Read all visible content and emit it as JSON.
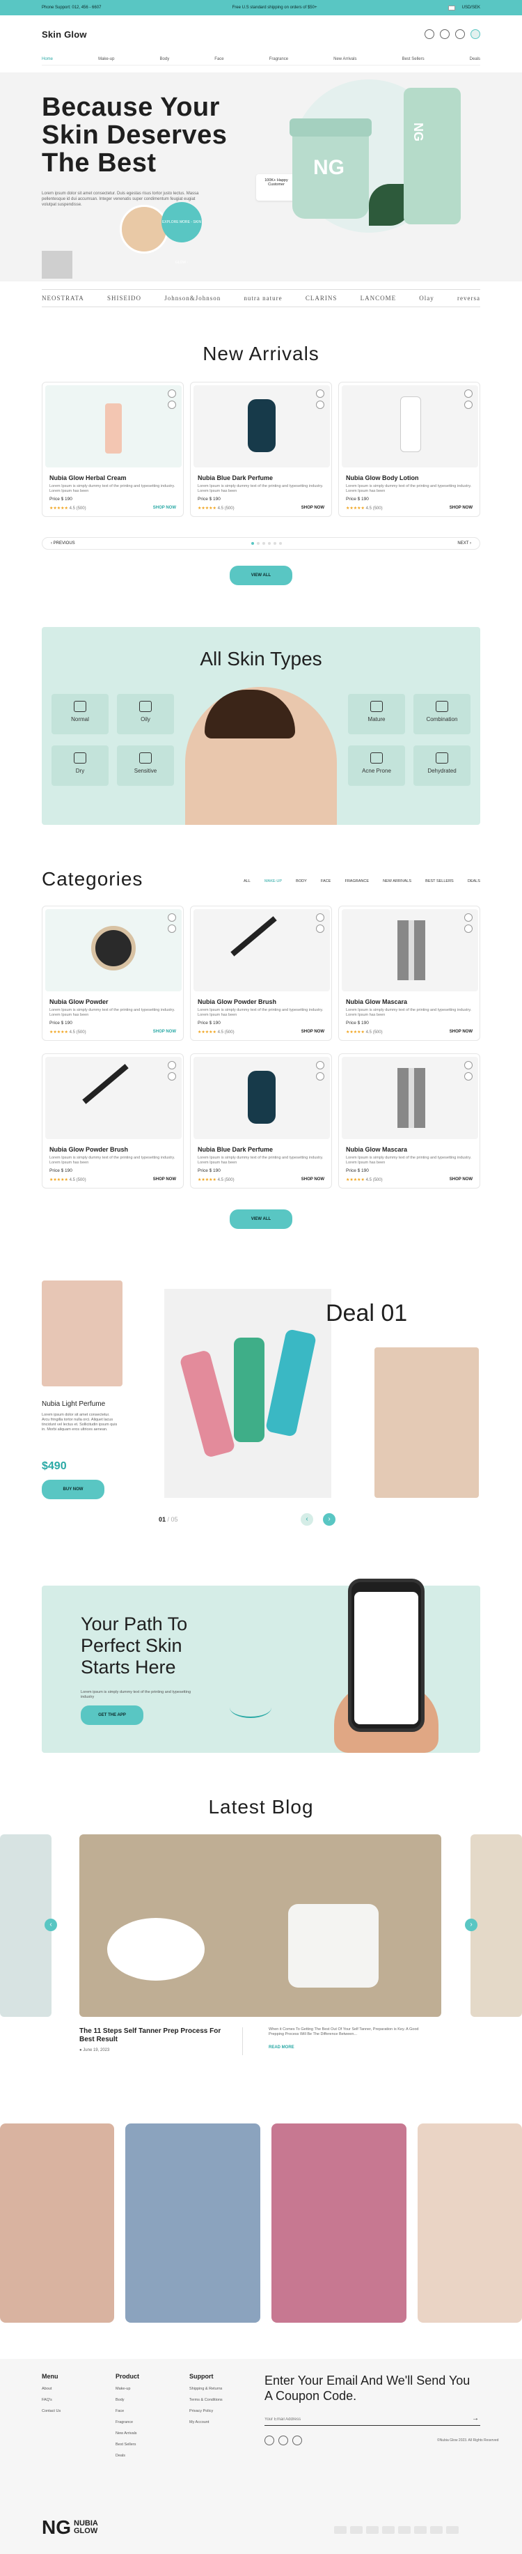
{
  "topbar": {
    "phone": "Phone Support: 012, 456 - 6607",
    "shipping": "Free U.S standard shipping on orders of $50+",
    "currency": "USD/SEK"
  },
  "header": {
    "logo": "Skin Glow"
  },
  "nav": [
    {
      "label": "Home",
      "active": true
    },
    {
      "label": "Make-up"
    },
    {
      "label": "Body"
    },
    {
      "label": "Face"
    },
    {
      "label": "Fragrance"
    },
    {
      "label": "New Arrivals"
    },
    {
      "label": "Best Sellers"
    },
    {
      "label": "Deals"
    }
  ],
  "hero": {
    "title": "Because Your Skin Deserves The Best",
    "desc": "Lorem ipsum dolor sit amet consectetur. Duis egestas risus tortor justo lectus. Massa pellentesque id dui accumsan. Integer venenatis super condimentum feugiat eugiat volutpat suspendisse.",
    "happy": "100K+ Happy Customer",
    "explore": "EXPLORE MORE - SKIN GLOW -",
    "product_mark": "NG"
  },
  "brands": [
    "NEOSTRATA",
    "SHISEIDO",
    "Johnson&Johnson",
    "nutra nature",
    "CLARINS",
    "LANCOME",
    "Olay",
    "reversa"
  ],
  "new_arrivals": {
    "title": "New Arrivals",
    "products": [
      {
        "name": "Nubia Glow Herbal Cream",
        "desc": "Lorem Ipsum is simply dummy text of the printing and typesetting industry. Lorem Ipsum has been",
        "price": "Price $ 190",
        "rating": "4.5 (500)",
        "cta": "SHOP NOW",
        "highlight": true
      },
      {
        "name": "Nubia Blue Dark Perfume",
        "desc": "Lorem Ipsum is simply dummy text of the printing and typesetting industry. Lorem Ipsum has been",
        "price": "Price $ 190",
        "rating": "4.5 (500)",
        "cta": "SHOP NOW"
      },
      {
        "name": "Nubia Glow Body Lotion",
        "desc": "Lorem Ipsum is simply dummy text of the printing and typesetting industry. Lorem Ipsum has been",
        "price": "Price $ 190",
        "rating": "4.5 (500)",
        "cta": "SHOP NOW"
      }
    ],
    "prev": "PREVIOUS",
    "next": "NEXT",
    "view_all": "VIEW ALL"
  },
  "skin_types": {
    "title": "All Skin Types",
    "types": [
      "Normal",
      "Oily",
      "Dry",
      "Sensitive",
      "Mature",
      "Combination",
      "Acne Prone",
      "Dehydrated"
    ]
  },
  "categories": {
    "title": "Categories",
    "tabs": [
      {
        "label": "ALL"
      },
      {
        "label": "MAKE-UP",
        "active": true
      },
      {
        "label": "BODY"
      },
      {
        "label": "FACE"
      },
      {
        "label": "FRAGRANCE"
      },
      {
        "label": "NEW ARRIVALS"
      },
      {
        "label": "BEST SELLERS"
      },
      {
        "label": "DEALS"
      }
    ],
    "products": [
      {
        "name": "Nubia Glow Powder",
        "desc": "Lorem Ipsum is simply dummy text of the printing and typesetting industry. Lorem Ipsum has been",
        "price": "Price $ 190",
        "rating": "4.5 (500)",
        "cta": "SHOP NOW",
        "highlight": true
      },
      {
        "name": "Nubia Glow Powder Brush",
        "desc": "Lorem Ipsum is simply dummy text of the printing and typesetting industry. Lorem Ipsum has been",
        "price": "Price $ 190",
        "rating": "4.5 (500)",
        "cta": "SHOP NOW"
      },
      {
        "name": "Nubia Glow Mascara",
        "desc": "Lorem Ipsum is simply dummy text of the printing and typesetting industry. Lorem Ipsum has been",
        "price": "Price $ 190",
        "rating": "4.5 (500)",
        "cta": "SHOP NOW"
      },
      {
        "name": "Nubia Glow Powder Brush",
        "desc": "Lorem Ipsum is simply dummy text of the printing and typesetting industry. Lorem Ipsum has been",
        "price": "Price $ 190",
        "rating": "4.5 (500)",
        "cta": "SHOP NOW"
      },
      {
        "name": "Nubia Blue Dark Perfume",
        "desc": "Lorem Ipsum is simply dummy text of the printing and typesetting industry. Lorem Ipsum has been",
        "price": "Price $ 190",
        "rating": "4.5 (500)",
        "cta": "SHOP NOW"
      },
      {
        "name": "Nubia Glow Mascara",
        "desc": "Lorem Ipsum is simply dummy text of the printing and typesetting industry. Lorem Ipsum has been",
        "price": "Price $ 190",
        "rating": "4.5 (500)",
        "cta": "SHOP NOW"
      }
    ],
    "view_all": "VIEW ALL"
  },
  "deal": {
    "title": "Deal 01",
    "product": "Nubia Light Perfume",
    "desc": "Lorem ipsum dolor sit amet consectetur. Arcu fringilla tortor nulla orci. Aliquet lacus tincidunt vel lectus et. Sollicitudin ipsum quis in. Morbi aliquam eros ultrices aenean.",
    "price": "$490",
    "cta": "BUY NOW",
    "counter_current": "01",
    "counter_total": "/ 05"
  },
  "app_promo": {
    "title": "Your Path To Perfect Skin Starts Here",
    "desc": "Lorem ipsum is simply dummy text of the printing and typesetting industry",
    "cta": "GET THE APP"
  },
  "blog": {
    "title": "Latest Blog",
    "post_title": "The 11 Steps Self Tanner Prep Process For Best Result",
    "post_date": "June 19, 2023",
    "post_excerpt": "When it Comes To Getting The Best Out Of Your Self Tanner, Preparation is Key. A Good Prepping Process Will Be The Difference Between...",
    "read_more": "READ MORE"
  },
  "footer": {
    "menu": {
      "title": "Menu",
      "items": [
        "About",
        "FAQ's",
        "Contact Us"
      ]
    },
    "product": {
      "title": "Product",
      "items": [
        "Make-up",
        "Body",
        "Face",
        "Fragrance",
        "New Arrivals",
        "Best Sellers",
        "Deals"
      ]
    },
    "support": {
      "title": "Support",
      "items": [
        "Shipping & Returns",
        "Terms & Conditions",
        "Privacy Policy",
        "My Account"
      ]
    },
    "newsletter_title": "Enter Your Email And We'll Send You A Coupon Code.",
    "email_placeholder": "Your Email Address",
    "logo_line1": "NUBIA",
    "logo_line2": "GLOW",
    "copyright": "©Nubia Glow 2023. All Rights Reserved"
  },
  "colors": {
    "accent": "#59c6c3",
    "mint_bg": "#d5ede7",
    "star": "#f0a31c"
  }
}
